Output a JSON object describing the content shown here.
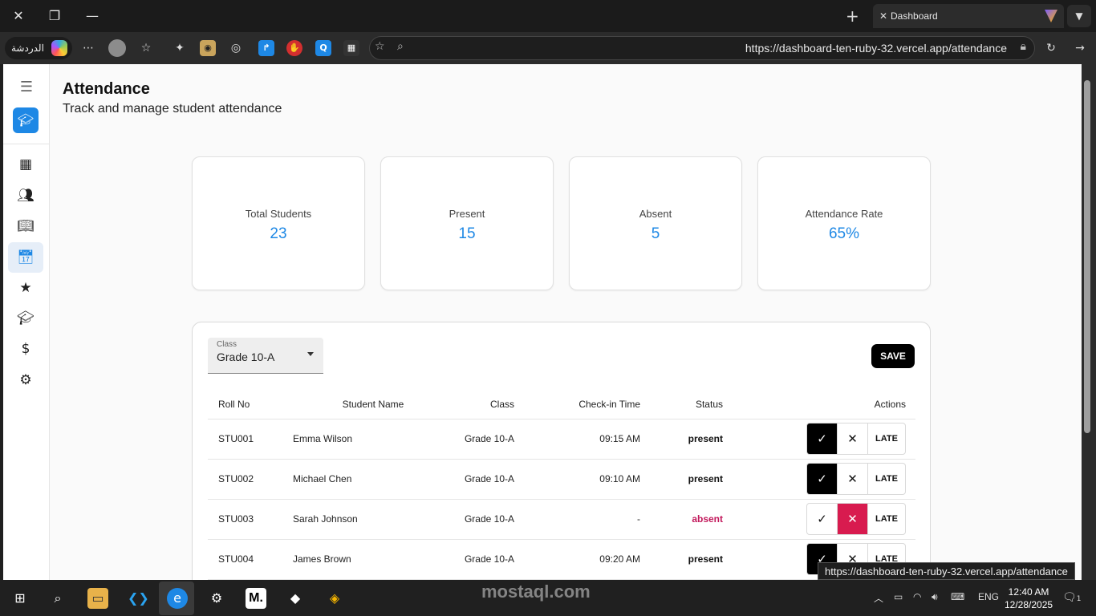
{
  "browser": {
    "tab_title": "Dashboard",
    "copilot_label": "الدردشة",
    "url": "https://dashboard-ten-ruby-32.vercel.app/attendance",
    "status_tooltip": "https://dashboard-ten-ruby-32.vercel.app/attendance"
  },
  "page": {
    "title": "Attendance",
    "subtitle": "Track and manage student attendance"
  },
  "sidebar": {
    "items": [
      {
        "icon": "dashboard-icon",
        "active": false
      },
      {
        "icon": "students-icon",
        "active": false
      },
      {
        "icon": "courses-icon",
        "active": false
      },
      {
        "icon": "attendance-calendar-icon",
        "active": true
      },
      {
        "icon": "star-icon",
        "active": false
      },
      {
        "icon": "graduation-cap-icon",
        "active": false
      },
      {
        "icon": "dollar-icon",
        "active": false
      },
      {
        "icon": "gear-icon",
        "active": false
      }
    ]
  },
  "stats": [
    {
      "label": "Total Students",
      "value": "23"
    },
    {
      "label": "Present",
      "value": "15"
    },
    {
      "label": "Absent",
      "value": "5"
    },
    {
      "label": "Attendance Rate",
      "value": "65%"
    }
  ],
  "controls": {
    "class_label": "Class",
    "class_value": "Grade 10-A",
    "save_label": "SAVE"
  },
  "table": {
    "headers": [
      "Roll No",
      "Student Name",
      "Class",
      "Check-in Time",
      "Status",
      "Actions"
    ],
    "late_label": "LATE",
    "rows": [
      {
        "roll": "STU001",
        "name": "Emma Wilson",
        "class": "Grade 10-A",
        "time": "09:15 AM",
        "status": "present"
      },
      {
        "roll": "STU002",
        "name": "Michael Chen",
        "class": "Grade 10-A",
        "time": "09:10 AM",
        "status": "present"
      },
      {
        "roll": "STU003",
        "name": "Sarah Johnson",
        "class": "Grade 10-A",
        "time": "-",
        "status": "absent"
      },
      {
        "roll": "STU004",
        "name": "James Brown",
        "class": "Grade 10-A",
        "time": "09:20 AM",
        "status": "present"
      }
    ]
  },
  "colors": {
    "accent": "#1e88e5",
    "absent": "#c2185b",
    "absent_button": "#d81b4f"
  },
  "taskbar": {
    "language": "ENG",
    "time": "12:40 AM",
    "date": "12/28/2025",
    "notifications": "1"
  },
  "watermark": "mostaql.com"
}
